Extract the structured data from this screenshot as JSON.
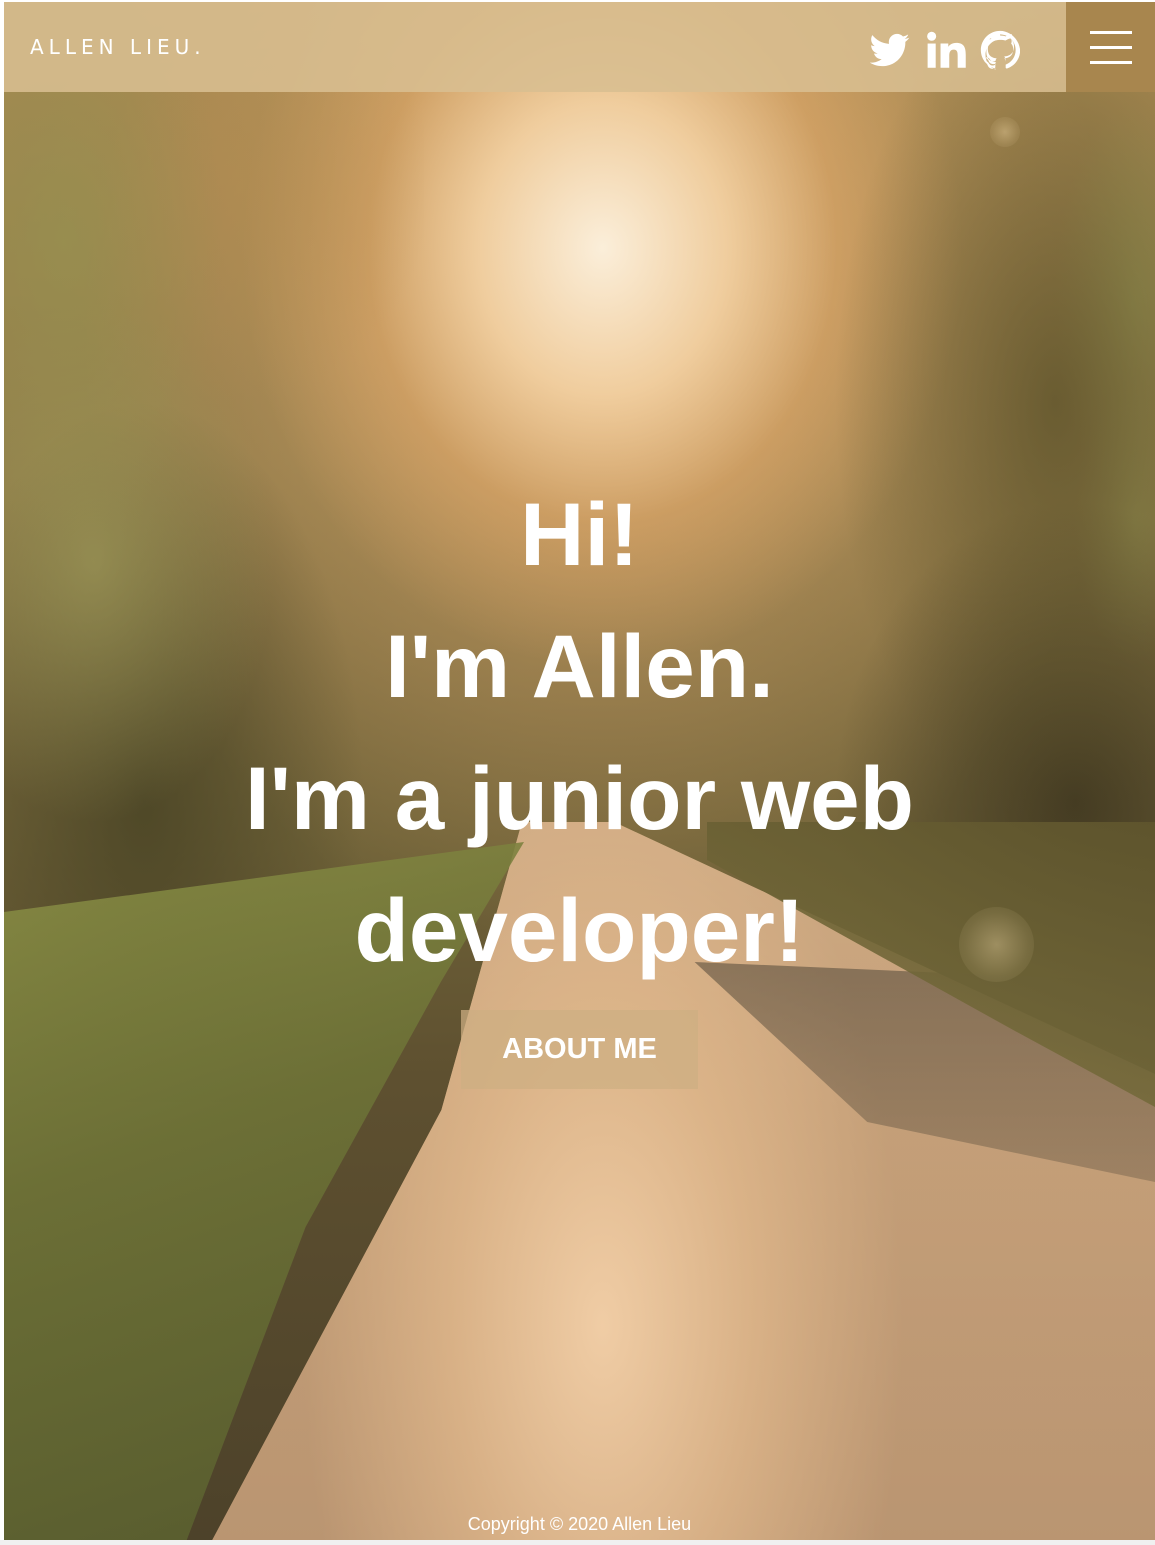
{
  "header": {
    "brand": "ALLEN LIEU.",
    "social": [
      {
        "name": "twitter",
        "icon": "twitter-icon"
      },
      {
        "name": "linkedin",
        "icon": "linkedin-icon"
      },
      {
        "name": "github",
        "icon": "github-icon"
      }
    ],
    "menu_icon": "hamburger-menu-icon"
  },
  "hero": {
    "lines": [
      "Hi!",
      "I'm Allen.",
      "I'm a junior web",
      "developer!"
    ],
    "button_label": "ABOUT ME"
  },
  "footer": {
    "copyright": "Copyright © 2020 Allen Lieu"
  },
  "colors": {
    "navbar": "#d8be91",
    "menu_button": "#a8864e",
    "text": "#ffffff"
  }
}
